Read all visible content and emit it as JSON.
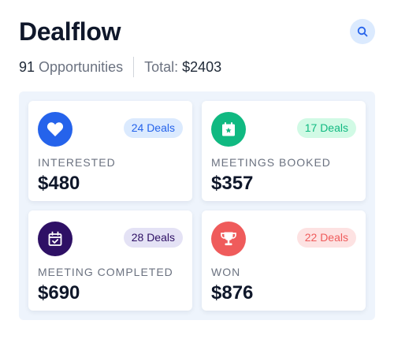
{
  "header": {
    "title": "Dealflow"
  },
  "summary": {
    "opportunities_count": "91",
    "opportunities_label": "Opportunities",
    "total_label": "Total:",
    "total_value": "$2403"
  },
  "cards": [
    {
      "label": "INTERESTED",
      "amount": "$480",
      "badge": "24 Deals",
      "icon": "heart-icon",
      "color": "#2563eb",
      "badge_bg": "#dbeafe",
      "badge_fg": "#2563eb"
    },
    {
      "label": "MEETINGS BOOKED",
      "amount": "$357",
      "badge": "17 Deals",
      "icon": "calendar-star-icon",
      "color": "#10b981",
      "badge_bg": "#d1fae5",
      "badge_fg": "#10b981"
    },
    {
      "label": "MEETING COMPLETED",
      "amount": "$690",
      "badge": "28 Deals",
      "icon": "calendar-check-icon",
      "color": "#2e1065",
      "badge_bg": "#e4e2f5",
      "badge_fg": "#2e1065"
    },
    {
      "label": "WON",
      "amount": "$876",
      "badge": "22 Deals",
      "icon": "trophy-icon",
      "color": "#ef5b5b",
      "badge_bg": "#fde2e2",
      "badge_fg": "#ef5b5b"
    }
  ],
  "colors": {
    "search_bg": "#dbeafe",
    "search_fg": "#2563eb",
    "panel_bg": "#eef4fc"
  }
}
